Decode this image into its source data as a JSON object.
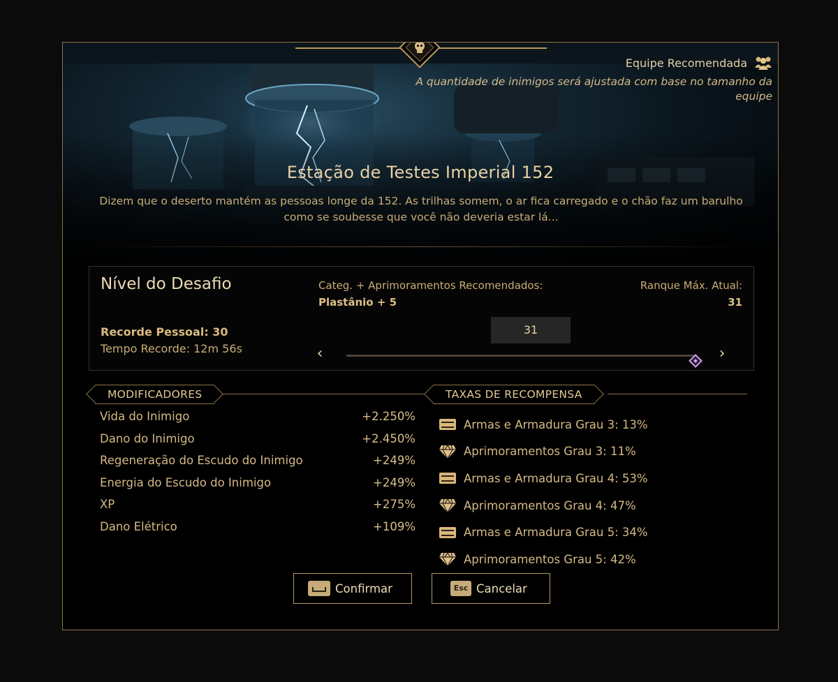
{
  "team": {
    "title": "Equipe Recomendada",
    "note": "A quantidade de inimigos será ajustada com base no tamanho da equipe",
    "icon": "people-group-icon"
  },
  "mission": {
    "title": "Estação de Testes Imperial 152",
    "description": "Dizem que o deserto mantém as pessoas longe da 152. As trilhas somem, o ar fica carregado e o chão faz um barulho como se soubesse que você não deveria estar lá..."
  },
  "challenge": {
    "title": "Nível do Desafio",
    "personal_best": "Recorde Pessoal: 30",
    "record_time": "Tempo Recorde: 12m 56s",
    "rec_upgrades_label": "Categ. + Aprimoramentos Recomendados:",
    "rec_upgrades_value": "Plastânio + 5",
    "max_rank_label": "Ranque Máx. Atual:",
    "max_rank_value": "31",
    "level_value": "31",
    "slider_fraction": 1.0
  },
  "modifiers": {
    "header": "MODIFICADORES",
    "rows": [
      {
        "name": "Vida do Inimigo",
        "value": "+2.250%"
      },
      {
        "name": "Dano do Inimigo",
        "value": "+2.450%"
      },
      {
        "name": "Regeneração do Escudo do Inimigo",
        "value": "+249%"
      },
      {
        "name": "Energia do Escudo do Inimigo",
        "value": "+249%"
      },
      {
        "name": "XP",
        "value": "+275%"
      },
      {
        "name": "Dano Elétrico",
        "value": "+109%"
      }
    ]
  },
  "rewards": {
    "header": "TAXAS DE RECOMPENSA",
    "rows": [
      {
        "icon": "chest-icon",
        "label": "Armas e Armadura Grau 3: 13%"
      },
      {
        "icon": "diamond-icon",
        "label": "Aprimoramentos Grau 3: 11%"
      },
      {
        "icon": "chest-icon",
        "label": "Armas e Armadura Grau 4: 53%"
      },
      {
        "icon": "diamond-icon",
        "label": "Aprimoramentos Grau 4: 47%"
      },
      {
        "icon": "chest-icon",
        "label": "Armas e Armadura Grau 5: 34%"
      },
      {
        "icon": "diamond-icon",
        "label": "Aprimoramentos Grau 5: 42%"
      }
    ]
  },
  "buttons": {
    "confirm_label": "Confirmar",
    "confirm_key": "space-key-icon",
    "cancel_label": "Cancelar",
    "cancel_key": "Esc"
  },
  "colors": {
    "accent_gold": "#b89a5f",
    "text_gold": "#e3cfa6",
    "slider_thumb": "#cfa0f0"
  }
}
